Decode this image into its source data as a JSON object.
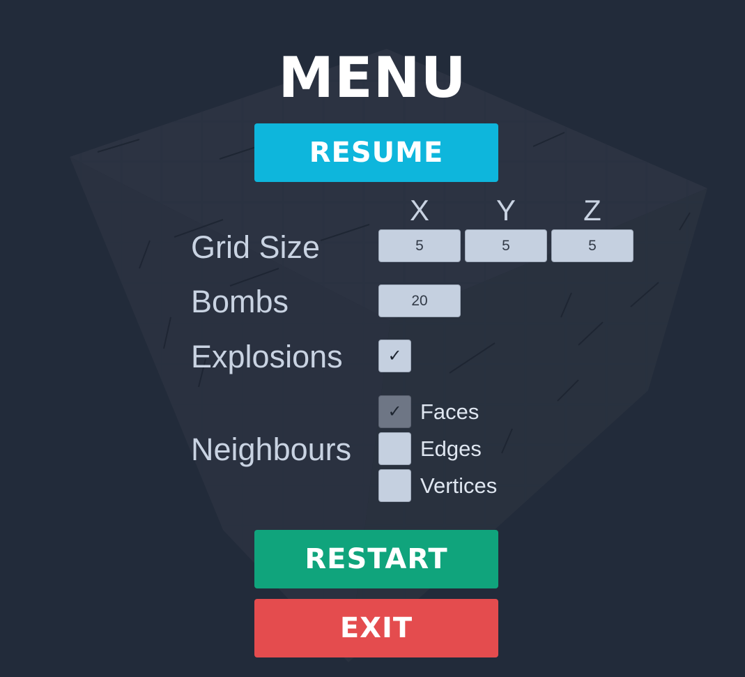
{
  "menu": {
    "title": "MENU",
    "resume_label": "RESUME",
    "restart_label": "RESTART",
    "exit_label": "EXIT"
  },
  "grid": {
    "axis_x": "X",
    "axis_y": "Y",
    "axis_z": "Z",
    "label": "Grid Size",
    "x": "5",
    "y": "5",
    "z": "5"
  },
  "bombs": {
    "label": "Bombs",
    "value": "20"
  },
  "explosions": {
    "label": "Explosions",
    "checked": true,
    "check_glyph": "✓"
  },
  "neighbours": {
    "label": "Neighbours",
    "options": [
      {
        "label": "Faces",
        "checked": true,
        "check_glyph": "✓"
      },
      {
        "label": "Edges",
        "checked": false,
        "check_glyph": ""
      },
      {
        "label": "Vertices",
        "checked": false,
        "check_glyph": ""
      }
    ]
  },
  "colors": {
    "background": "#222b3a",
    "resume": "#0eb6dc",
    "restart": "#10a47c",
    "exit": "#e44c4e",
    "field": "#c5d0e0",
    "label_text": "#c9d3e2"
  },
  "background_art": {
    "icon": "minesweeper-cube-icon"
  }
}
